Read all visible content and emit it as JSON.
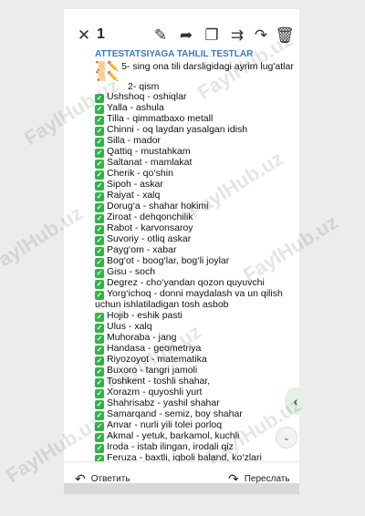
{
  "toolbar": {
    "count": "1",
    "icons": [
      "close-icon",
      "pencil-icon",
      "share-icon",
      "copy-icon",
      "forward-icon",
      "reply-icon",
      "trash-icon"
    ]
  },
  "message": {
    "channel_header": "ATTESTATSIYAGA TAHLIL TESTLAR",
    "intro_line1": "📜✏️ 5- sing ona tili darsligidagi ayrim lug'atlar 📜✏️",
    "intro_line2": "2- qism",
    "items": [
      "Ushshoq - oshiqlar",
      "Yalla - ashula",
      "Tilla - qimmatbaxo metall",
      "Chinni - oq laydan yasalgan idish",
      "Silla - mador",
      "Qattiq - mustahkam",
      "Saltanat - mamlakat",
      "Cherik - qo‘shin",
      "Sipoh - askar",
      "Raiyat - xalq",
      "Dorug‘a - shahar hokimi",
      "Ziroat - dehqonchilik",
      "Rabot - karvonsaroy",
      "Suvoriy - otliq askar",
      "Payg‘om - xabar",
      "Bog‘ot - boog‘lar, bog‘li joylar",
      "Gisu - soch",
      "Degrez - cho‘yandan qozon quyuvchi",
      "Yorg‘ichoq - donni maydalash va un qilish uchun ishlatiladigan tosh asbob",
      "Hojib - eshik pasti",
      "Ulus - xalq",
      "Muhoraba - jang",
      "Handasa - geometriya",
      "Riyozoyot - matematika",
      "Buxoro - tangri jamoli",
      "Toshkent - toshli shahar,",
      "Xorazm - quyoshli yurt",
      "Shahrisabz - yashil shahar",
      "Samarqand - semiz, boy shahar",
      "Anvar - nurli yili tolei porloq",
      "Akmal - yetuk, barkamol, kuchli",
      "Iroda - istab ilingan, irodali qiz",
      "Feruza - baxtli, iqboli baland, ko‘zlari"
    ]
  },
  "actions": {
    "reply_label": "Ответить",
    "forward_label": "Переслать"
  },
  "watermark": "FaylHub.uz",
  "colors": {
    "header": "#3a78c3",
    "check": "#33b249"
  }
}
